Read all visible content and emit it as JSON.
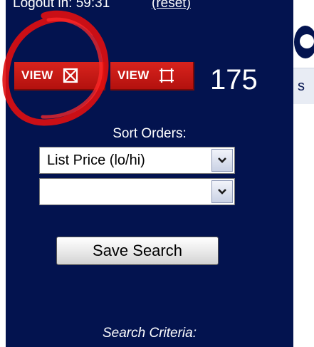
{
  "header": {
    "login_text": "Logout in: 59:31",
    "reset_link": "(reset)"
  },
  "view_buttons": [
    {
      "label": "VIEW",
      "icon": "map-icon"
    },
    {
      "label": "VIEW",
      "icon": "frame-icon"
    }
  ],
  "result_count": "175",
  "sort": {
    "label": "Sort Orders:",
    "primary_value": "List Price (lo/hi)",
    "secondary_value": ""
  },
  "save_button": "Save Search",
  "criteria_label": "Search Criteria:",
  "right_panel": {
    "letter": "s"
  },
  "colors": {
    "sidebar_bg": "#03134f",
    "button_red": "#c81a15",
    "annotation_red": "#e01010"
  }
}
